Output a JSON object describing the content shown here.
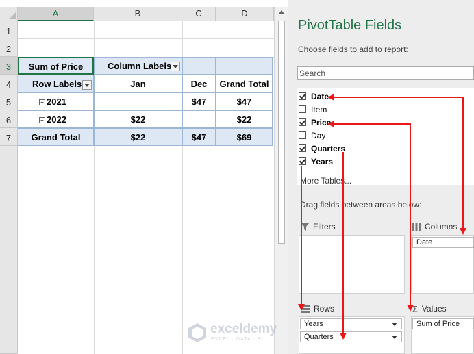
{
  "spreadsheet": {
    "columns": [
      "A",
      "B",
      "C",
      "D"
    ],
    "rows": [
      "1",
      "2",
      "3",
      "4",
      "5",
      "6",
      "7"
    ],
    "pivot": {
      "header_value": "Sum of Price",
      "column_labels": "Column Labels",
      "row_labels": "Row Labels",
      "col_jan": "Jan",
      "col_dec": "Dec",
      "col_grand_total": "Grand Total",
      "rows": [
        {
          "label": "2021",
          "jan": "",
          "dec": "$47",
          "total": "$47"
        },
        {
          "label": "2022",
          "jan": "$22",
          "dec": "",
          "total": "$22"
        }
      ],
      "grand_total_label": "Grand Total",
      "grand_total_jan": "$22",
      "grand_total_dec": "$47",
      "grand_total_total": "$69"
    }
  },
  "pane": {
    "title": "PivotTable Fields",
    "subtitle": "Choose fields to add to report:",
    "search_placeholder": "Search",
    "fields": [
      {
        "label": "Date",
        "checked": true,
        "bold": true
      },
      {
        "label": "Item",
        "checked": false,
        "bold": false
      },
      {
        "label": "Price",
        "checked": true,
        "bold": true
      },
      {
        "label": "Day",
        "checked": false,
        "bold": false
      },
      {
        "label": "Quarters",
        "checked": true,
        "bold": true
      },
      {
        "label": "Years",
        "checked": true,
        "bold": true
      }
    ],
    "more_tables": "More Tables...",
    "drag_hint": "Drag fields between areas below:",
    "areas": {
      "filters": {
        "label": "Filters"
      },
      "columns": {
        "label": "Columns",
        "items": [
          "Date"
        ]
      },
      "rows": {
        "label": "Rows",
        "items": [
          "Years",
          "Quarters"
        ]
      },
      "values": {
        "label": "Values",
        "items": [
          "Sum of Price"
        ]
      }
    }
  },
  "watermark": {
    "name": "exceldemy",
    "tagline": "EXCEL · DATA · BI"
  },
  "colors": {
    "accent": "#217346",
    "pivot_fill": "#dde8f4",
    "arrow": "#e81818"
  },
  "icons": [
    "filter-icon",
    "columns-icon",
    "rows-icon",
    "values-icon",
    "expand-icon",
    "dropdown-arrow-icon"
  ]
}
